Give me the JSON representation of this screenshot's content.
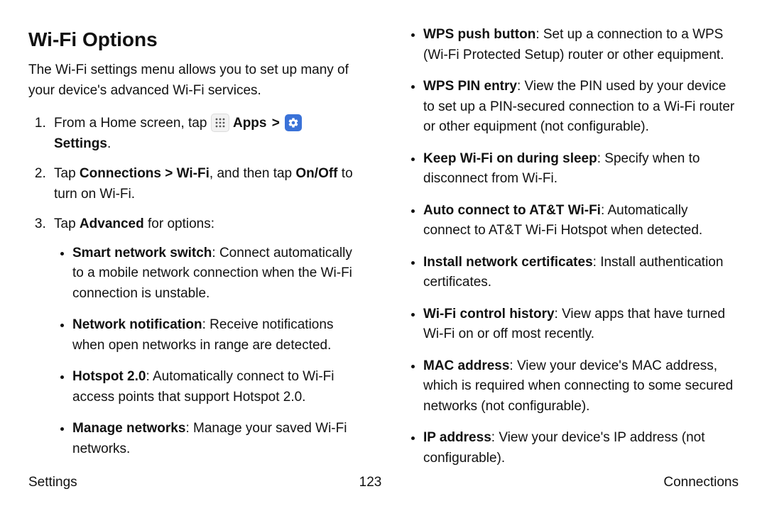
{
  "title": "Wi-Fi Options",
  "intro": "The Wi-Fi settings menu allows you to set up many of your device's advanced Wi-Fi services.",
  "step1": {
    "prefix": "From a Home screen, tap ",
    "apps_label": "Apps",
    "chevron": ">",
    "settings_label": "Settings",
    "suffix": "."
  },
  "step2": {
    "t1": "Tap ",
    "connections": "Connections",
    "sep1": " > ",
    "wifi": "Wi-Fi",
    "t2": ", and then tap ",
    "onoff": "On/Off",
    "t3": " to turn on Wi-Fi."
  },
  "step3": {
    "t1": "Tap ",
    "advanced": "Advanced",
    "t2": " for options:"
  },
  "options_left": [
    {
      "label": "Smart network switch",
      "desc": ": Connect automatically to a mobile network connection when the Wi-Fi connection is unstable."
    },
    {
      "label": "Network notification",
      "desc": ": Receive notifications when open networks in range are detected."
    },
    {
      "label": "Hotspot 2.0",
      "desc": ": Automatically connect to Wi-Fi access points that support Hotspot 2.0."
    },
    {
      "label": "Manage networks",
      "desc": ": Manage your saved Wi-Fi networks."
    }
  ],
  "options_right": [
    {
      "label": "WPS push button",
      "desc": ": Set up a connection to a WPS (Wi-Fi Protected Setup) router or other equipment."
    },
    {
      "label": "WPS PIN entry",
      "desc": ": View the PIN used by your device to set up a PIN-secured connection to a Wi-Fi router or other equipment (not configurable)."
    },
    {
      "label": "Keep Wi-Fi on during sleep",
      "desc": ": Specify when to disconnect from Wi-Fi."
    },
    {
      "label": "Auto connect to AT&T Wi-Fi",
      "desc": ": Automatically connect to AT&T Wi-Fi Hotspot when detected."
    },
    {
      "label": "Install network certificates",
      "desc": ": Install authentication certificates."
    },
    {
      "label": "Wi-Fi control history",
      "desc": ": View apps that have turned Wi-Fi on or off most recently."
    },
    {
      "label": "MAC address",
      "desc": ": View your device's MAC address, which is required when connecting to some secured networks (not configurable)."
    },
    {
      "label": "IP address",
      "desc": ": View your device's IP address (not configurable)."
    }
  ],
  "footer": {
    "left": "Settings",
    "center": "123",
    "right": "Connections"
  }
}
